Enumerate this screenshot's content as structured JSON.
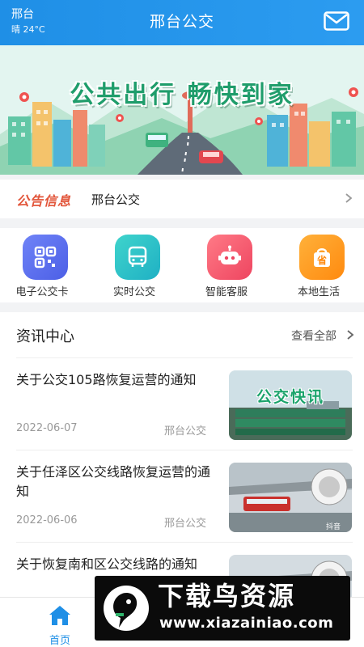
{
  "header": {
    "city": "邢台",
    "weather": "晴 24°C",
    "title": "邢台公交",
    "mail_icon": "mail-icon"
  },
  "banner": {
    "slogan": "公共出行  畅快到家"
  },
  "notice": {
    "tag": "公告信息",
    "text": "邢台公交"
  },
  "menu": [
    {
      "label": "电子公交卡",
      "icon": "qr-card-icon",
      "color": "#5b6cf0"
    },
    {
      "label": "实时公交",
      "icon": "bus-icon",
      "color": "#26c1c8"
    },
    {
      "label": "智能客服",
      "icon": "robot-icon",
      "color": "#f2596b"
    },
    {
      "label": "本地生活",
      "icon": "shopping-bag-icon",
      "color": "#ff9b1a"
    }
  ],
  "news": {
    "heading": "资讯中心",
    "more": "查看全部",
    "articles": [
      {
        "title": "关于公交105路恢复运营的通知",
        "date": "2022-06-07",
        "source": "邢台公交",
        "thumb_text": "公交快讯"
      },
      {
        "title": "关于任泽区公交线路恢复运营的通知",
        "date": "2022-06-06",
        "source": "邢台公交",
        "thumb_text": "抖音"
      },
      {
        "title": "关于恢复南和区公交线路的通知",
        "date": "",
        "source": "",
        "thumb_text": ""
      }
    ]
  },
  "tabbar": {
    "home_label": "首页"
  },
  "watermark": {
    "title": "下载鸟资源",
    "url": "www.xiazainiao.com"
  }
}
